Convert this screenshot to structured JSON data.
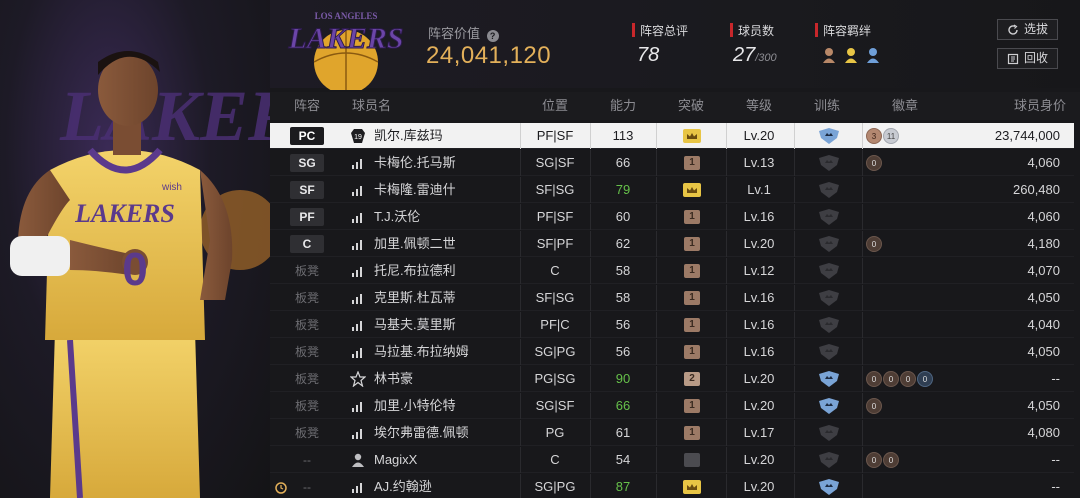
{
  "team": {
    "logo_text": "LAKERS",
    "logo_sub": "LOS ANGELES",
    "value_label": "阵容价值",
    "value": "24,041,120"
  },
  "stats": {
    "rating_label": "阵容总评",
    "rating_value": "78",
    "count_label": "球员数",
    "count_value": "27",
    "count_max": "/300",
    "synergy_label": "阵容羁绊"
  },
  "buttons": {
    "filter": "选拔",
    "back": "回收"
  },
  "hero": {
    "jersey_team": "LAKERS",
    "jersey_number": "0",
    "sponsor": "wish",
    "bg_text": "LAKERS"
  },
  "columns": {
    "lineup": "阵容",
    "name": "球员名",
    "position": "位置",
    "ability": "能力",
    "breakthrough": "突破",
    "level": "等级",
    "training": "训练",
    "badges": "徽章",
    "value": "球员身价"
  },
  "players": [
    {
      "slot": "PC",
      "starter": true,
      "icon": "jersey-19",
      "name": "凯尔.库兹玛",
      "pos": "PF|SF",
      "ability": "113",
      "green": false,
      "brk": "gold",
      "brk_text": "",
      "level": "Lv.20",
      "train": "blue",
      "medals": [
        {
          "t": "copper",
          "n": "3"
        },
        {
          "t": "silver",
          "n": "11"
        }
      ],
      "value": "23,744,000",
      "sel": true
    },
    {
      "slot": "SG",
      "starter": true,
      "icon": "signal",
      "name": "卡梅伦.托马斯",
      "pos": "SG|SF",
      "ability": "66",
      "green": false,
      "brk": "brown",
      "brk_text": "1",
      "level": "Lv.13",
      "train": "grey",
      "medals": [
        {
          "t": "brown",
          "n": "0"
        }
      ],
      "value": "4,060"
    },
    {
      "slot": "SF",
      "starter": true,
      "icon": "signal",
      "name": "卡梅隆.雷迪什",
      "pos": "SF|SG",
      "ability": "79",
      "green": true,
      "brk": "gold",
      "brk_text": "",
      "level": "Lv.1",
      "train": "grey",
      "medals": [],
      "value": "260,480"
    },
    {
      "slot": "PF",
      "starter": true,
      "icon": "signal",
      "name": "T.J.沃伦",
      "pos": "PF|SF",
      "ability": "60",
      "green": false,
      "brk": "brown",
      "brk_text": "1",
      "level": "Lv.16",
      "train": "grey",
      "medals": [],
      "value": "4,060"
    },
    {
      "slot": "C",
      "starter": true,
      "icon": "signal",
      "name": "加里.佩顿二世",
      "pos": "SF|PF",
      "ability": "62",
      "green": false,
      "brk": "brown",
      "brk_text": "1",
      "level": "Lv.20",
      "train": "grey",
      "medals": [
        {
          "t": "brown",
          "n": "0"
        }
      ],
      "value": "4,180"
    },
    {
      "slot": "板凳",
      "starter": false,
      "icon": "signal",
      "name": "托尼.布拉德利",
      "pos": "C",
      "ability": "58",
      "green": false,
      "brk": "brown",
      "brk_text": "1",
      "level": "Lv.12",
      "train": "grey",
      "medals": [],
      "value": "4,070"
    },
    {
      "slot": "板凳",
      "starter": false,
      "icon": "signal",
      "name": "克里斯.杜瓦蒂",
      "pos": "SF|SG",
      "ability": "58",
      "green": false,
      "brk": "brown",
      "brk_text": "1",
      "level": "Lv.16",
      "train": "grey",
      "medals": [],
      "value": "4,050"
    },
    {
      "slot": "板凳",
      "starter": false,
      "icon": "signal",
      "name": "马基夫.莫里斯",
      "pos": "PF|C",
      "ability": "56",
      "green": false,
      "brk": "brown",
      "brk_text": "1",
      "level": "Lv.16",
      "train": "grey",
      "medals": [],
      "value": "4,040"
    },
    {
      "slot": "板凳",
      "starter": false,
      "icon": "signal",
      "name": "马拉基.布拉纳姆",
      "pos": "SG|PG",
      "ability": "56",
      "green": false,
      "brk": "brown",
      "brk_text": "1",
      "level": "Lv.16",
      "train": "grey",
      "medals": [],
      "value": "4,050"
    },
    {
      "slot": "板凳",
      "starter": false,
      "icon": "star",
      "name": "林书豪",
      "pos": "PG|SG",
      "ability": "90",
      "green": true,
      "brk": "brown2",
      "brk_text": "2",
      "level": "Lv.20",
      "train": "blue",
      "medals": [
        {
          "t": "brown",
          "n": "0"
        },
        {
          "t": "brown",
          "n": "0"
        },
        {
          "t": "brown",
          "n": "0"
        },
        {
          "t": "blue",
          "n": "0"
        }
      ],
      "value": "--"
    },
    {
      "slot": "板凳",
      "starter": false,
      "icon": "signal",
      "name": "加里.小特伦特",
      "pos": "SG|SF",
      "ability": "66",
      "green": true,
      "brk": "brown",
      "brk_text": "1",
      "level": "Lv.20",
      "train": "blue",
      "medals": [
        {
          "t": "brown",
          "n": "0"
        }
      ],
      "value": "4,050"
    },
    {
      "slot": "板凳",
      "starter": false,
      "icon": "signal",
      "name": "埃尔弗雷德.佩顿",
      "pos": "PG",
      "ability": "61",
      "green": false,
      "brk": "brown",
      "brk_text": "1",
      "level": "Lv.17",
      "train": "grey",
      "medals": [],
      "value": "4,080"
    },
    {
      "slot": "--",
      "starter": false,
      "icon": "person",
      "name": "MagixX",
      "pos": "C",
      "ability": "54",
      "green": false,
      "brk": "grey",
      "brk_text": "",
      "level": "Lv.20",
      "train": "grey",
      "medals": [
        {
          "t": "brown",
          "n": "0"
        },
        {
          "t": "brown",
          "n": "0"
        }
      ],
      "value": "--"
    },
    {
      "slot": "--",
      "starter": false,
      "icon": "signal",
      "name": "AJ.约翰逊",
      "pos": "SG|PG",
      "ability": "87",
      "green": true,
      "brk": "gold",
      "brk_text": "",
      "level": "Lv.20",
      "train": "blue",
      "medals": [],
      "value": "--",
      "alarm": true
    }
  ],
  "colors": {
    "accent_gold": "#e3b05a",
    "lakers_purple": "#5b3a8c",
    "lakers_gold": "#f0c64a",
    "stat_red": "#c8272b",
    "green": "#66c04a"
  }
}
